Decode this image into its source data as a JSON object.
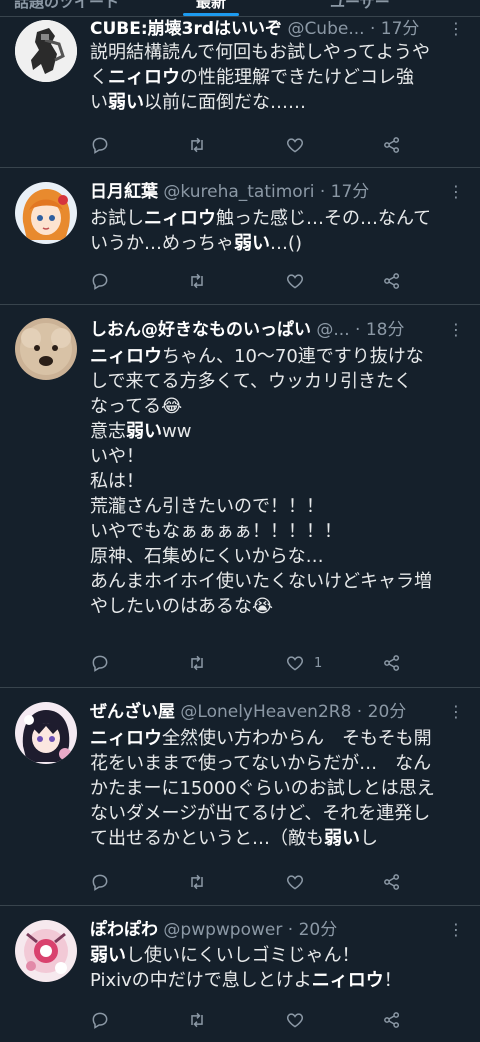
{
  "top_tabs": [
    "話題のツイート",
    "最新",
    "ユーザー"
  ],
  "icons": {
    "reply": "reply-icon",
    "retweet": "retweet-icon",
    "like": "heart-icon",
    "share": "share-icon",
    "more": "more-icon"
  },
  "colors": {
    "background": "#15202b",
    "accent": "#1d9bf0",
    "secondary_text": "#8b98a5",
    "divider": "#38444d"
  },
  "tweets": [
    {
      "name": "CUBE:崩壊3rdはいいぞ",
      "handle": "@Cube...",
      "sep": " · ",
      "time": "17分",
      "lines": [
        [
          {
            "t": "説明結構読んで何回もお試しやってようや"
          }
        ],
        [
          {
            "t": "く"
          },
          {
            "t": "ニィロウ",
            "b": true
          },
          {
            "t": "の性能理解できたけどコレ強"
          }
        ],
        [
          {
            "t": "い"
          },
          {
            "t": "弱い",
            "b": true
          },
          {
            "t": "以前に面倒だな……"
          }
        ]
      ],
      "like_count": ""
    },
    {
      "name": "日月紅葉",
      "handle": "@kureha_tatimori",
      "sep": " · ",
      "time": "17分",
      "lines": [
        [
          {
            "t": "お試し"
          },
          {
            "t": "ニィロウ",
            "b": true
          },
          {
            "t": "触った感じ…その…なんて"
          }
        ],
        [
          {
            "t": "いうか…めっちゃ"
          },
          {
            "t": "弱い",
            "b": true
          },
          {
            "t": "…()"
          }
        ]
      ],
      "like_count": ""
    },
    {
      "name": "しおん@好きなものいっぱい",
      "handle": "@...",
      "sep": " · ",
      "time": "18分",
      "lines": [
        [
          {
            "t": "ニィロウ",
            "b": true
          },
          {
            "t": "ちゃん、10〜70連ですり抜けな"
          }
        ],
        [
          {
            "t": "しで来てる方多くて、ウッカリ引きたく"
          }
        ],
        [
          {
            "t": "なってる😂"
          }
        ],
        [
          {
            "t": "意志"
          },
          {
            "t": "弱い",
            "b": true
          },
          {
            "t": "ww"
          }
        ],
        [
          {
            "t": "いや！"
          }
        ],
        [
          {
            "t": "私は！"
          }
        ],
        [
          {
            "t": "荒瀧さん引きたいので！！！"
          }
        ],
        [
          {
            "t": "いやでもなぁぁぁぁ！！！！！"
          }
        ],
        [
          {
            "t": "原神、石集めにくいからな…"
          }
        ],
        [
          {
            "t": "あんまホイホイ使いたくないけどキャラ増"
          }
        ],
        [
          {
            "t": "やしたいのはあるな😭"
          }
        ]
      ],
      "like_count": "1"
    },
    {
      "name": "ぜんざい屋",
      "handle": "@LonelyHeaven2R8",
      "sep": " · ",
      "time": "20分",
      "lines": [
        [
          {
            "t": "ニィロウ",
            "b": true
          },
          {
            "t": "全然使い方わからん　そもそも開"
          }
        ],
        [
          {
            "t": "花をいままで使ってないからだが…　なん"
          }
        ],
        [
          {
            "t": "かたまーに15000ぐらいのお試しとは思え"
          }
        ],
        [
          {
            "t": "ないダメージが出てるけど、それを連発し"
          }
        ],
        [
          {
            "t": "て出せるかというと…（敵も"
          },
          {
            "t": "弱い",
            "b": true
          },
          {
            "t": "し"
          }
        ]
      ],
      "like_count": ""
    },
    {
      "name": "ぽわぽわ",
      "handle": "@pwpwpower",
      "sep": " · ",
      "time": "20分",
      "lines": [
        [
          {
            "t": "弱い",
            "b": true
          },
          {
            "t": "し使いにくいしゴミじゃん！"
          }
        ],
        [
          {
            "t": "Pixivの中だけで息しとけよ"
          },
          {
            "t": "ニィロウ",
            "b": true
          },
          {
            "t": "！"
          }
        ]
      ],
      "like_count": ""
    }
  ]
}
